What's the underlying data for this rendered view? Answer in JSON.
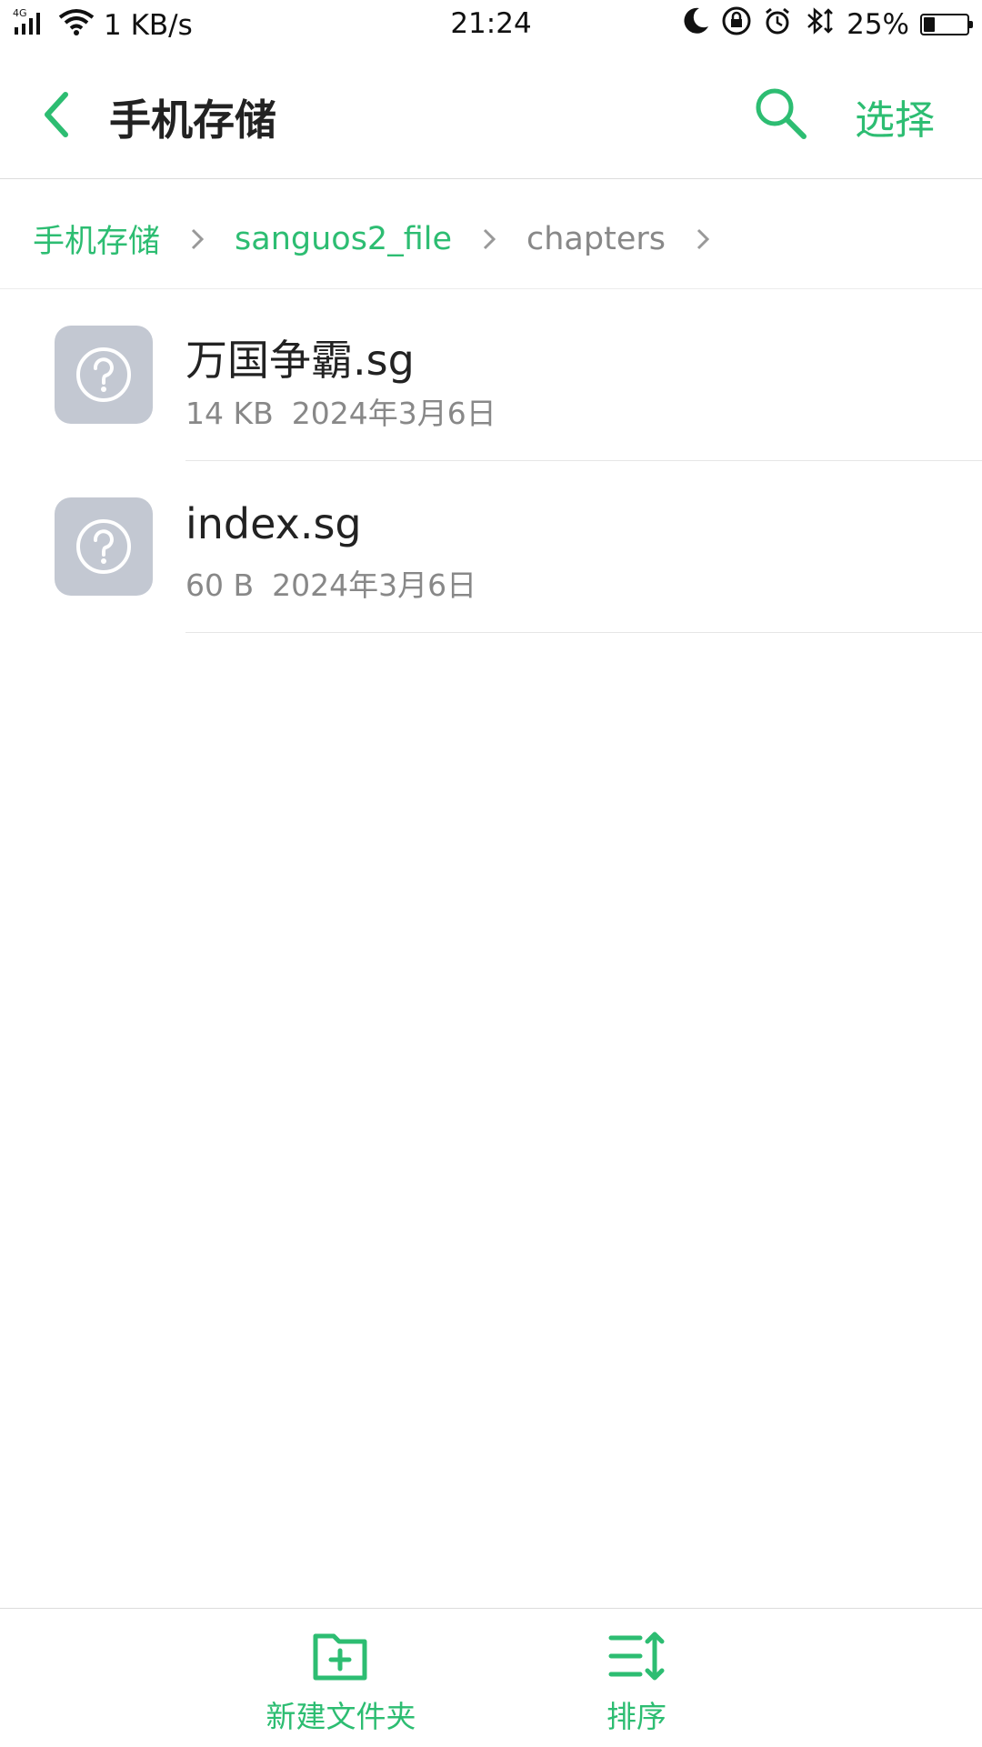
{
  "status_bar": {
    "network": "4G",
    "speed": "1 KB/s",
    "time": "21:24",
    "battery": "25%",
    "battery_level": 0.25
  },
  "app_bar": {
    "title": "手机存储",
    "select_label": "选择"
  },
  "breadcrumb": [
    {
      "label": "手机存储"
    },
    {
      "label": "sanguos2_file"
    },
    {
      "label": "chapters"
    }
  ],
  "files": [
    {
      "name": "万国争霸.sg",
      "size": "14 KB",
      "date": "2024年3月6日"
    },
    {
      "name": "index.sg",
      "size": "60 B",
      "date": "2024年3月6日"
    }
  ],
  "bottom_bar": {
    "new_folder_label": "新建文件夹",
    "sort_label": "排序"
  },
  "colors": {
    "accent": "#2dbd72",
    "file_icon_bg": "#c3c8d2",
    "secondary_text": "#888888"
  }
}
